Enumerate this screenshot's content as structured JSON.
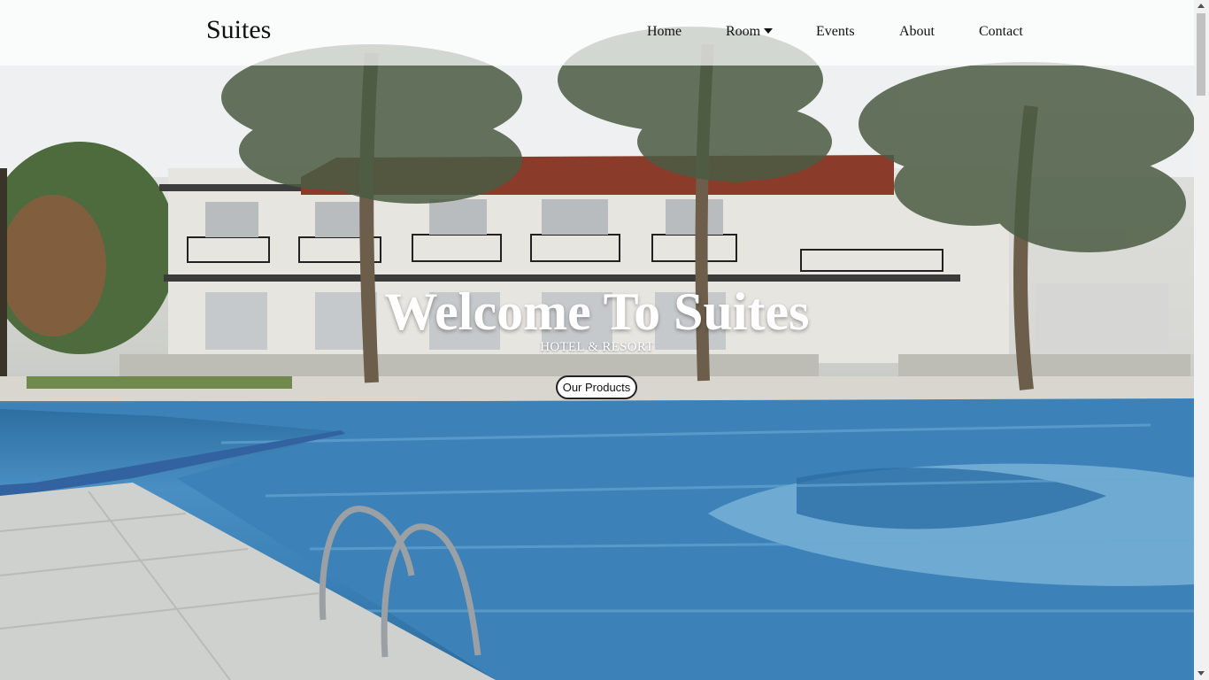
{
  "navbar": {
    "brand": "Suites",
    "items": [
      {
        "label": "Home"
      },
      {
        "label": "Room",
        "has_dropdown": true
      },
      {
        "label": "Events"
      },
      {
        "label": "About"
      },
      {
        "label": "Contact"
      }
    ]
  },
  "hero": {
    "title": "Welcome To Suites",
    "subtitle": "HOTEL & RESORT",
    "cta_label": "Our Products",
    "image_subject": "resort-pool-with-palm-trees"
  },
  "colors": {
    "navbar_bg": "#ffffffb8",
    "text_dark": "#111111",
    "hero_text": "#ffffff",
    "pool_blue": "#3a7fb5"
  },
  "icons": {
    "room_dropdown": "caret-down-icon"
  }
}
